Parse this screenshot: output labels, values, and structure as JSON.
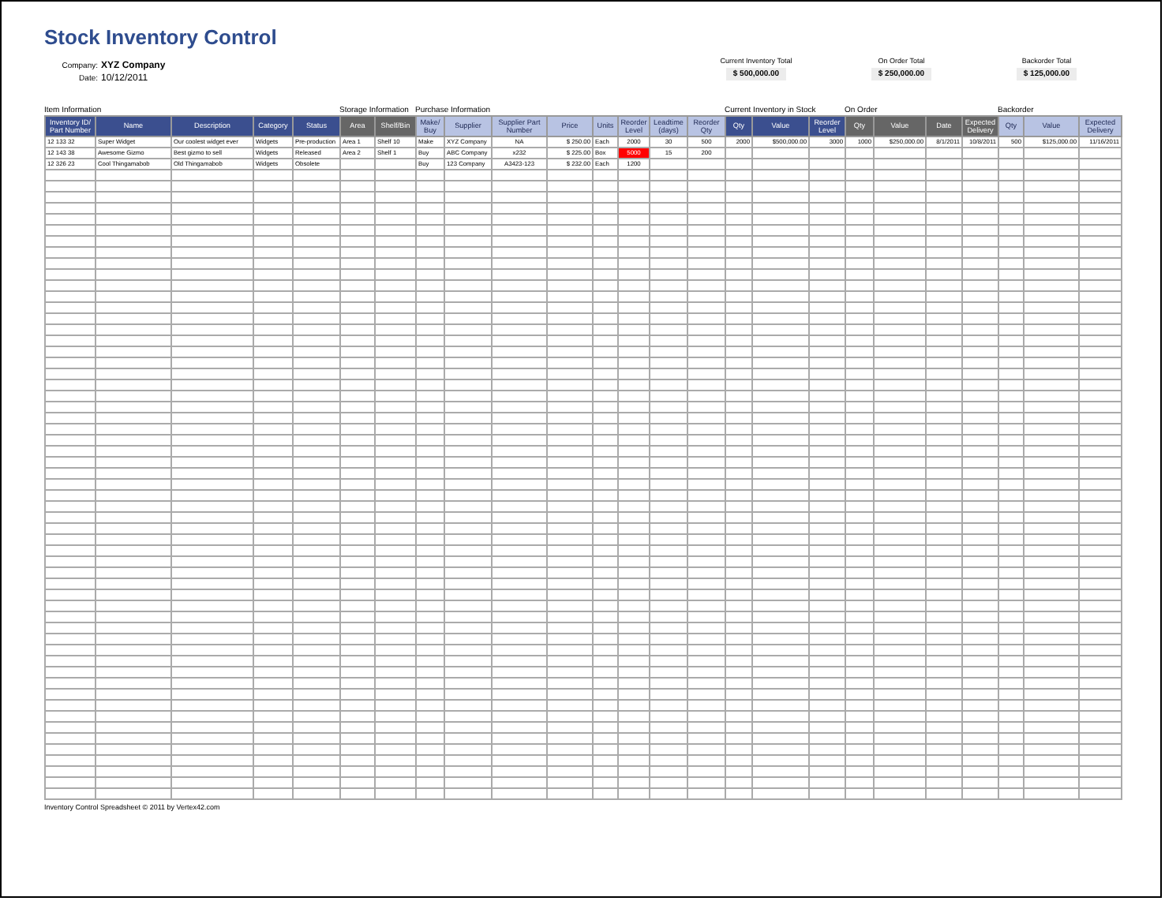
{
  "title": "Stock Inventory Control",
  "company": {
    "label": "Company:",
    "value": "XYZ Company"
  },
  "date": {
    "label": "Date:",
    "value": "10/12/2011"
  },
  "totals": [
    {
      "label": "Current Inventory Total",
      "value": "$ 500,000.00"
    },
    {
      "label": "On Order Total",
      "value": "$ 250,000.00"
    },
    {
      "label": "Backorder Total",
      "value": "$ 125,000.00"
    }
  ],
  "groups": [
    {
      "label": "Item Information",
      "columns": [
        "Inventory ID/ Part Number",
        "Name",
        "Description",
        "Category",
        "Status"
      ]
    },
    {
      "label": "Storage Information",
      "columns": [
        "Area",
        "Shelf/Bin"
      ]
    },
    {
      "label": "Purchase Information",
      "columns": [
        "Make/ Buy",
        "Supplier",
        "Supplier Part Number",
        "Price",
        "Units",
        "Reorder Level",
        "Leadtime (days)",
        "Reorder Qty"
      ]
    },
    {
      "label": "Current Inventory in Stock",
      "columns": [
        "Qty",
        "Value",
        "Reorder Level"
      ]
    },
    {
      "label": "On Order",
      "columns": [
        "Qty",
        "Value",
        "Date",
        "Expected Delivery"
      ]
    },
    {
      "label": "Backorder",
      "columns": [
        "Qty",
        "Value",
        "Expected Delivery"
      ]
    }
  ],
  "rows": [
    {
      "reorder_alert": false,
      "cells": [
        "12 133 32",
        "Super Widget",
        "Our coolest widget ever",
        "Widgets",
        "Pre-production",
        "Area 1",
        "Shelf 10",
        "Make",
        "XYZ Company",
        "NA",
        "$ 250.00",
        "Each",
        "2000",
        "30",
        "500",
        "2000",
        "$500,000.00",
        "3000",
        "1000",
        "$250,000.00",
        "8/1/2011",
        "10/8/2011",
        "500",
        "$125,000.00",
        "11/16/2011"
      ]
    },
    {
      "reorder_alert": true,
      "cells": [
        "12 143 38",
        "Awesome Gizmo",
        "Best gizmo to sell",
        "Widgets",
        "Released",
        "Area 2",
        "Shelf 1",
        "Buy",
        "ABC Company",
        "x232",
        "$ 225.00",
        "Box",
        "5000",
        "15",
        "200",
        "",
        "",
        "",
        "",
        "",
        "",
        "",
        "",
        "",
        ""
      ]
    },
    {
      "reorder_alert": false,
      "cells": [
        "12 326 23",
        "Cool Thingamabob",
        "Old Thingamabob",
        "Widgets",
        "Obsolete",
        "",
        "",
        "Buy",
        "123 Company",
        "A3423-123",
        "$ 232.00",
        "Each",
        "1200",
        "",
        "",
        "",
        "",
        "",
        "",
        "",
        "",
        "",
        "",
        "",
        ""
      ]
    }
  ],
  "footer": "Inventory Control Spreadsheet © 2011 by Vertex42.com"
}
